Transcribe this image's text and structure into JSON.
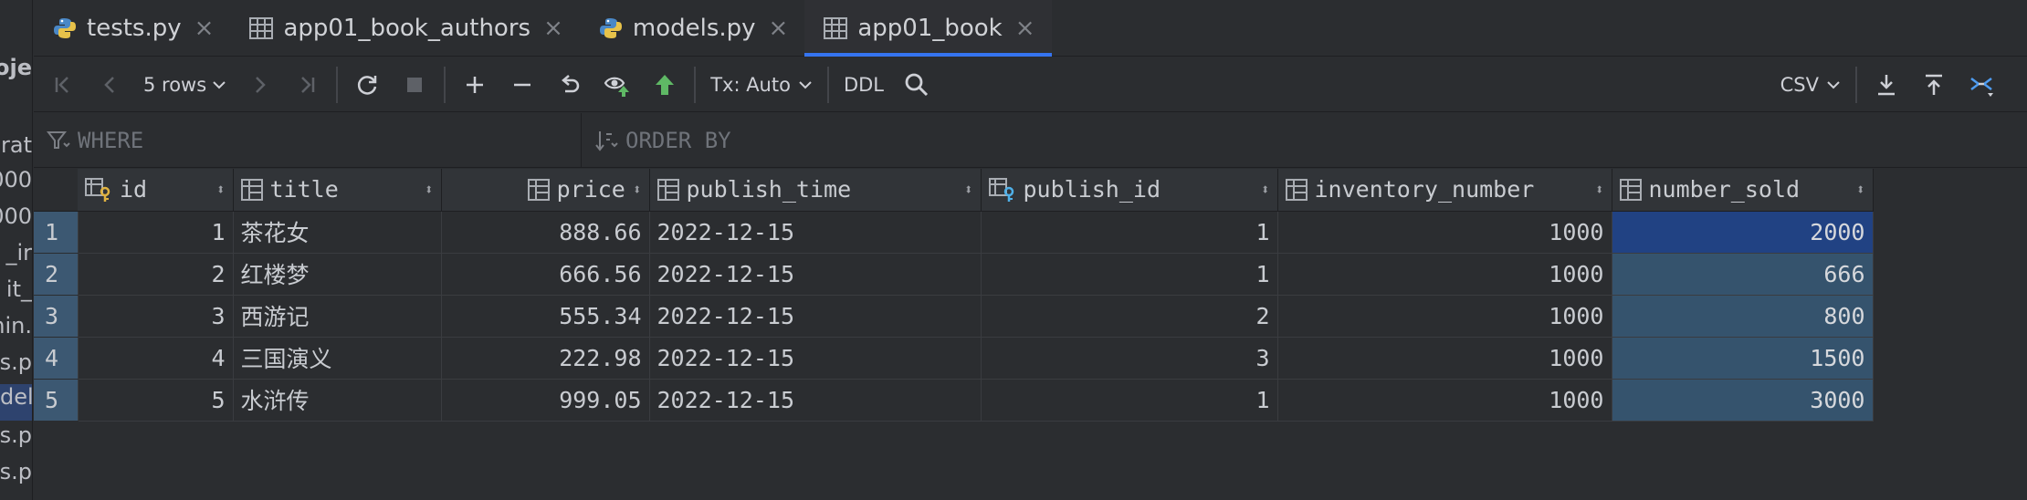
{
  "project_strip": [
    "oje",
    "grat",
    "000",
    "000",
    "_ir",
    "it_",
    "min.",
    "os.p",
    "del",
    "ts.p",
    "ws.p"
  ],
  "tabs": [
    {
      "label": "tests.py",
      "icon": "python-file-icon",
      "active": false
    },
    {
      "label": "app01_book_authors",
      "icon": "table-icon",
      "active": false
    },
    {
      "label": "models.py",
      "icon": "python-file-icon",
      "active": false
    },
    {
      "label": "app01_book",
      "icon": "table-icon",
      "active": true
    }
  ],
  "toolbar": {
    "rows_label": "5 rows",
    "tx_label": "Tx: Auto",
    "ddl_label": "DDL",
    "export_format": "CSV"
  },
  "filter": {
    "where_placeholder": "WHERE",
    "order_placeholder": "ORDER BY"
  },
  "columns": [
    {
      "name": "id",
      "icon": "primary-key-column-icon"
    },
    {
      "name": "title",
      "icon": "column-icon"
    },
    {
      "name": "price",
      "icon": "column-icon"
    },
    {
      "name": "publish_time",
      "icon": "column-icon"
    },
    {
      "name": "publish_id",
      "icon": "foreign-key-column-icon"
    },
    {
      "name": "inventory_number",
      "icon": "column-icon"
    },
    {
      "name": "number_sold",
      "icon": "column-icon"
    }
  ],
  "rows": [
    {
      "n": "1",
      "id": "1",
      "title": "茶花女",
      "price": "888.66",
      "publish_time": "2022-12-15",
      "publish_id": "1",
      "inventory_number": "1000",
      "number_sold": "2000"
    },
    {
      "n": "2",
      "id": "2",
      "title": "红楼梦",
      "price": "666.56",
      "publish_time": "2022-12-15",
      "publish_id": "1",
      "inventory_number": "1000",
      "number_sold": "666"
    },
    {
      "n": "3",
      "id": "3",
      "title": "西游记",
      "price": "555.34",
      "publish_time": "2022-12-15",
      "publish_id": "2",
      "inventory_number": "1000",
      "number_sold": "800"
    },
    {
      "n": "4",
      "id": "4",
      "title": "三国演义",
      "price": "222.98",
      "publish_time": "2022-12-15",
      "publish_id": "3",
      "inventory_number": "1000",
      "number_sold": "1500"
    },
    {
      "n": "5",
      "id": "5",
      "title": "水浒传",
      "price": "999.05",
      "publish_time": "2022-12-15",
      "publish_id": "1",
      "inventory_number": "1000",
      "number_sold": "3000"
    }
  ],
  "colors": {
    "accent": "#3574f0",
    "selection": "#35536d",
    "current_cell": "#214283",
    "add_green": "#5fb865"
  }
}
